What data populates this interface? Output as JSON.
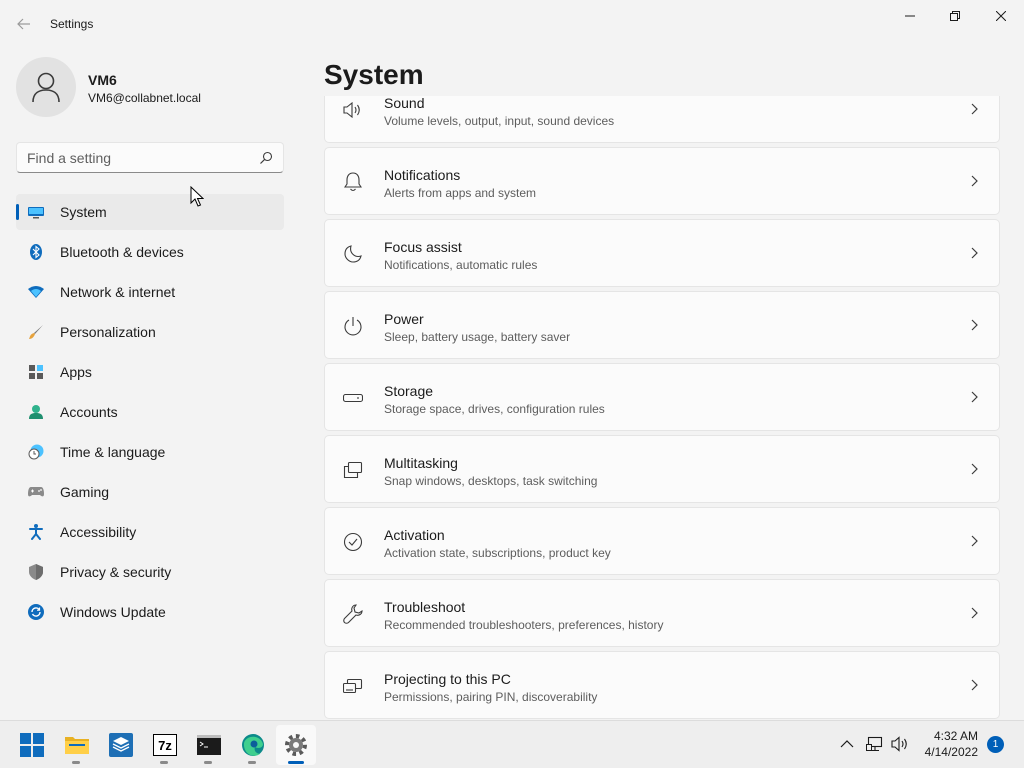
{
  "window": {
    "title": "Settings",
    "back_icon": "back-arrow-icon",
    "controls": [
      "minimize",
      "maximize",
      "close"
    ]
  },
  "profile": {
    "name": "VM6",
    "email": "VM6@collabnet.local"
  },
  "search": {
    "placeholder": "Find a setting",
    "value": ""
  },
  "nav": {
    "items": [
      {
        "label": "System",
        "icon": "system-icon",
        "active": true
      },
      {
        "label": "Bluetooth & devices",
        "icon": "bluetooth-icon"
      },
      {
        "label": "Network & internet",
        "icon": "wifi-icon"
      },
      {
        "label": "Personalization",
        "icon": "brush-icon"
      },
      {
        "label": "Apps",
        "icon": "apps-icon"
      },
      {
        "label": "Accounts",
        "icon": "accounts-icon"
      },
      {
        "label": "Time & language",
        "icon": "clock-globe-icon"
      },
      {
        "label": "Gaming",
        "icon": "gamepad-icon"
      },
      {
        "label": "Accessibility",
        "icon": "accessibility-icon"
      },
      {
        "label": "Privacy & security",
        "icon": "shield-icon"
      },
      {
        "label": "Windows Update",
        "icon": "update-icon"
      }
    ]
  },
  "main": {
    "title": "System",
    "cards": [
      {
        "title": "Sound",
        "subtitle": "Volume levels, output, input, sound devices",
        "icon": "speaker-icon"
      },
      {
        "title": "Notifications",
        "subtitle": "Alerts from apps and system",
        "icon": "bell-icon"
      },
      {
        "title": "Focus assist",
        "subtitle": "Notifications, automatic rules",
        "icon": "moon-icon"
      },
      {
        "title": "Power",
        "subtitle": "Sleep, battery usage, battery saver",
        "icon": "power-icon"
      },
      {
        "title": "Storage",
        "subtitle": "Storage space, drives, configuration rules",
        "icon": "drive-icon"
      },
      {
        "title": "Multitasking",
        "subtitle": "Snap windows, desktops, task switching",
        "icon": "multitask-icon"
      },
      {
        "title": "Activation",
        "subtitle": "Activation state, subscriptions, product key",
        "icon": "check-circle-icon"
      },
      {
        "title": "Troubleshoot",
        "subtitle": "Recommended troubleshooters, preferences, history",
        "icon": "wrench-icon"
      },
      {
        "title": "Projecting to this PC",
        "subtitle": "Permissions, pairing PIN, discoverability",
        "icon": "projector-icon"
      }
    ]
  },
  "taskbar": {
    "apps": [
      {
        "name": "Start",
        "icon": "windows-start-icon"
      },
      {
        "name": "File Explorer",
        "icon": "folder-icon",
        "running": true
      },
      {
        "name": "VirtualBox",
        "icon": "box-icon"
      },
      {
        "name": "7-Zip",
        "icon": "7zip-icon",
        "label": "7z",
        "running": true
      },
      {
        "name": "Command Prompt",
        "icon": "terminal-icon",
        "running": true
      },
      {
        "name": "Microsoft Edge",
        "icon": "edge-icon",
        "running": true
      },
      {
        "name": "Settings",
        "icon": "settings-gear-icon",
        "running": true,
        "active": true
      }
    ],
    "tray": {
      "time": "4:32 AM",
      "date": "4/14/2022",
      "notification_count": "1"
    }
  },
  "colors": {
    "accent": "#005fb8",
    "background": "#f3f3f3",
    "card": "#fbfbfb"
  }
}
